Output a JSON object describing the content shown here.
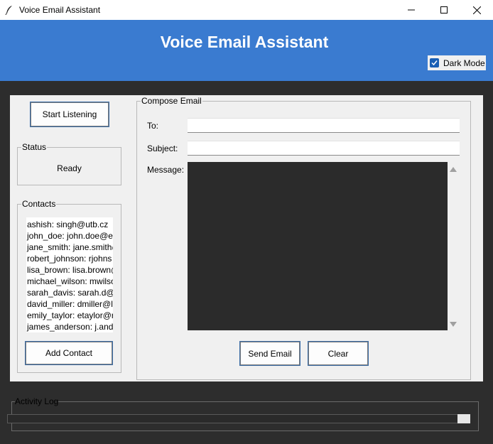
{
  "window": {
    "title": "Voice Email Assistant",
    "controls": {
      "minimize": "–",
      "maximize": "□",
      "close": "✕"
    }
  },
  "header": {
    "title": "Voice Email Assistant",
    "dark_mode_label": "Dark Mode",
    "dark_mode_checked": true,
    "accent_color": "#3a7bd0"
  },
  "left": {
    "start_listening_label": "Start Listening",
    "status": {
      "group_label": "Status",
      "value": "Ready"
    },
    "contacts": {
      "group_label": "Contacts",
      "items": [
        "ashish: singh@utb.cz",
        "john_doe: john.doe@ex",
        "jane_smith: jane.smith@",
        "robert_johnson: rjohns",
        "lisa_brown: lisa.brown@",
        "michael_wilson: mwilso",
        "sarah_davis: sarah.d@u",
        "david_miller: dmiller@l",
        "emily_taylor: etaylor@r",
        "james_anderson: j.ande"
      ],
      "add_contact_label": "Add Contact"
    }
  },
  "compose": {
    "group_label": "Compose Email",
    "to_label": "To:",
    "to_value": "",
    "subject_label": "Subject:",
    "subject_value": "",
    "message_label": "Message:",
    "message_value": "",
    "send_label": "Send Email",
    "clear_label": "Clear"
  },
  "activity_log": {
    "group_label": "Activity Log"
  }
}
